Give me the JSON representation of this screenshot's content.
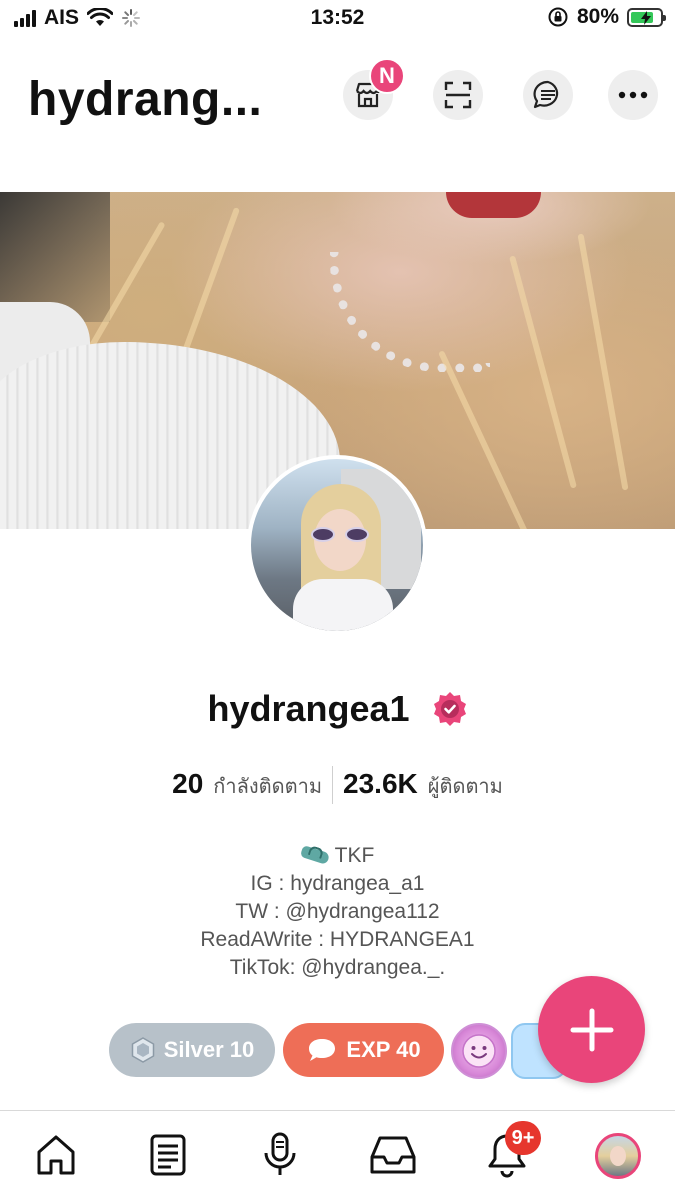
{
  "status_bar": {
    "carrier": "AIS",
    "time": "13:52",
    "battery_percent": "80%",
    "battery_level": 0.8,
    "icons": [
      "signal-icon",
      "wifi-icon",
      "loading-spinner-icon",
      "orientation-lock-icon",
      "battery-charging-icon"
    ]
  },
  "header": {
    "title": "hydrang...",
    "shop_badge": "N",
    "icons": [
      "shop-icon",
      "scan-icon",
      "message-icon",
      "more-icon"
    ]
  },
  "profile": {
    "username": "hydrangea1",
    "verified": true,
    "following_count": "20",
    "following_label": "กำลังติดตาม",
    "followers_count": "23.6K",
    "followers_label": "ผู้ติดตาม",
    "bio": [
      "TKF",
      "IG : hydrangea_a1",
      "TW : @hydrangea112",
      "ReadAWrite : HYDRANGEA1",
      "TikTok: @hydrangea._."
    ]
  },
  "chips": {
    "silver": "Silver 10",
    "exp": "EXP 40"
  },
  "colors": {
    "accent": "#e9457a",
    "silver_chip": "#b7c1c9",
    "exp_chip": "#ee6e57",
    "notification_badge": "#e6362d"
  },
  "bottom_nav": {
    "notification_badge": "9+",
    "items": [
      "home-icon",
      "feed-icon",
      "microphone-icon",
      "inbox-icon",
      "bell-icon",
      "profile-avatar"
    ]
  }
}
